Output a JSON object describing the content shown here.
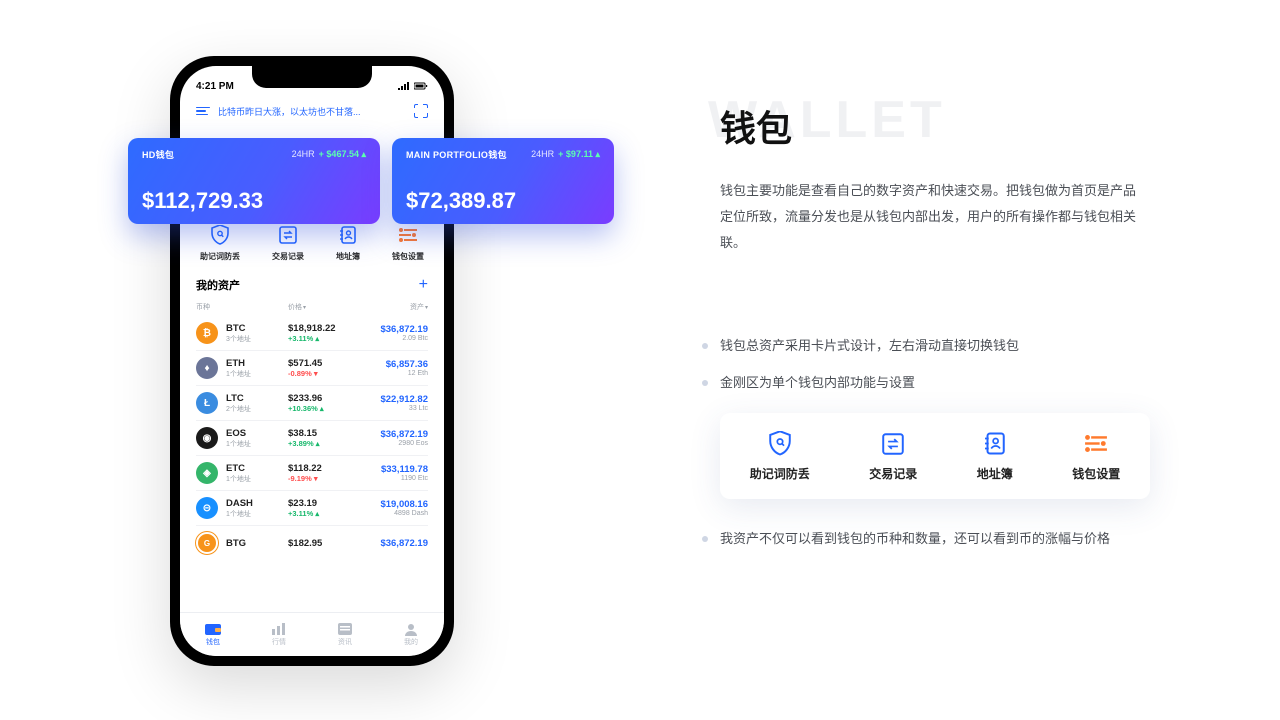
{
  "statusbar": {
    "time": "4:21 PM"
  },
  "news": {
    "text": "比特币昨日大涨，以太坊也不甘落..."
  },
  "cards": [
    {
      "name": "HD钱包",
      "period": "24HR",
      "change": "+ $467.54",
      "amount": "$112,729.33"
    },
    {
      "name": "MAIN PORTFOLIO钱包",
      "period": "24HR",
      "change": "+ $97.11",
      "amount": "$72,389.87"
    }
  ],
  "quick": [
    {
      "label": "助记词防丢"
    },
    {
      "label": "交易记录"
    },
    {
      "label": "地址簿"
    },
    {
      "label": "钱包设置"
    }
  ],
  "assets": {
    "title": "我的资产",
    "cols": {
      "c1": "币种",
      "c2": "价格",
      "c3": "资产"
    },
    "rows": [
      {
        "ico": "c-btc",
        "glyph": "₿",
        "sym": "BTC",
        "sub": "3个地址",
        "price": "$18,918.22",
        "pct": "+3.11%",
        "dir": "up",
        "val": "$36,872.19",
        "qty": "2.09 Btc"
      },
      {
        "ico": "c-eth",
        "glyph": "♦",
        "sym": "ETH",
        "sub": "1个地址",
        "price": "$571.45",
        "pct": "-0.89%",
        "dir": "down",
        "val": "$6,857.36",
        "qty": "12 Eth"
      },
      {
        "ico": "c-ltc",
        "glyph": "Ł",
        "sym": "LTC",
        "sub": "2个地址",
        "price": "$233.96",
        "pct": "+10.36%",
        "dir": "up",
        "val": "$22,912.82",
        "qty": "33 Ltc"
      },
      {
        "ico": "c-eos",
        "glyph": "◉",
        "sym": "EOS",
        "sub": "1个地址",
        "price": "$38.15",
        "pct": "+3.89%",
        "dir": "up",
        "val": "$36,872.19",
        "qty": "2980 Eos"
      },
      {
        "ico": "c-etc",
        "glyph": "◈",
        "sym": "ETC",
        "sub": "1个地址",
        "price": "$118.22",
        "pct": "-9.19%",
        "dir": "down",
        "val": "$33,119.78",
        "qty": "1190 Etc"
      },
      {
        "ico": "c-dash",
        "glyph": "⊝",
        "sym": "DASH",
        "sub": "1个地址",
        "price": "$23.19",
        "pct": "+3.11%",
        "dir": "up",
        "val": "$19,008.16",
        "qty": "4898 Dash"
      },
      {
        "ico": "c-btg",
        "glyph": "G",
        "sym": "BTG",
        "sub": "",
        "price": "$182.95",
        "pct": "",
        "dir": "up",
        "val": "$36,872.19",
        "qty": ""
      }
    ]
  },
  "tabs": [
    {
      "label": "钱包",
      "active": true
    },
    {
      "label": "行情",
      "active": false
    },
    {
      "label": "资讯",
      "active": false
    },
    {
      "label": "我的",
      "active": false
    }
  ],
  "right": {
    "watermark": "WALLET",
    "title": "钱包",
    "desc": "钱包主要功能是查看自己的数字资产和快速交易。把钱包做为首页是产品定位所致，流量分发也是从钱包内部出发，用户的所有操作都与钱包相关联。",
    "p1": "钱包总资产采用卡片式设计，左右滑动直接切换钱包",
    "p2": "金刚区为单个钱包内部功能与设置",
    "p3": "我资产不仅可以看到钱包的币种和数量，还可以看到币的涨幅与价格",
    "features": [
      {
        "label": "助记词防丢"
      },
      {
        "label": "交易记录"
      },
      {
        "label": "地址簿"
      },
      {
        "label": "钱包设置"
      }
    ]
  }
}
